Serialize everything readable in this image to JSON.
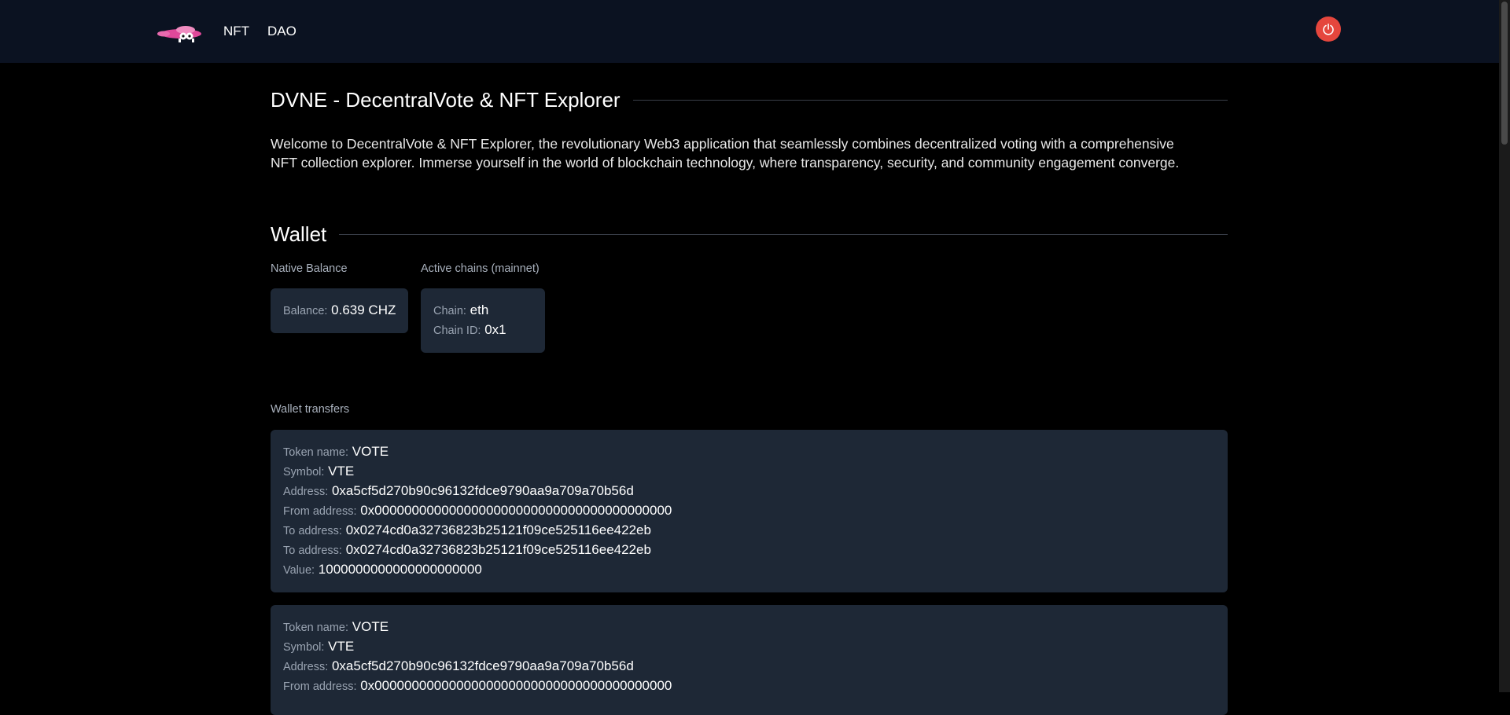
{
  "nav": {
    "links": [
      "NFT",
      "DAO"
    ]
  },
  "intro": {
    "title": "DVNE - DecentralVote & NFT Explorer",
    "text": "Welcome to DecentralVote & NFT Explorer, the revolutionary Web3 application that seamlessly combines decentralized voting with a comprehensive NFT collection explorer. Immerse yourself in the world of blockchain technology, where transparency, security, and community engagement converge."
  },
  "wallet": {
    "title": "Wallet",
    "native_balance_label": "Native Balance",
    "balance_key": "Balance:",
    "balance_value": "0.639 CHZ",
    "active_chains_label": "Active chains (mainnet)",
    "chain_key": "Chain:",
    "chain_value": "eth",
    "chain_id_key": "Chain ID:",
    "chain_id_value": "0x1",
    "transfers_label": "Wallet transfers"
  },
  "transfers": [
    {
      "token_name": "VOTE",
      "symbol": "VTE",
      "address": "0xa5cf5d270b90c96132fdce9790aa9a709a70b56d",
      "from_address": "0x0000000000000000000000000000000000000000",
      "to_address_1": "0x0274cd0a32736823b25121f09ce525116ee422eb",
      "to_address_2": "0x0274cd0a32736823b25121f09ce525116ee422eb",
      "value": "1000000000000000000000"
    },
    {
      "token_name": "VOTE",
      "symbol": "VTE",
      "address": "0xa5cf5d270b90c96132fdce9790aa9a709a70b56d",
      "from_address": "0x0000000000000000000000000000000000000000"
    }
  ],
  "labels": {
    "token_name": "Token name:",
    "symbol": "Symbol:",
    "address": "Address:",
    "from_address": "From address:",
    "to_address": "To address:",
    "value": "Value:"
  },
  "icons": {
    "logo": "platypus-logo",
    "power": "power-icon"
  },
  "colors": {
    "topbar": "#0b1221",
    "card": "#1e2836",
    "power_button": "#e5463d",
    "logo_pink": "#e0489a"
  }
}
